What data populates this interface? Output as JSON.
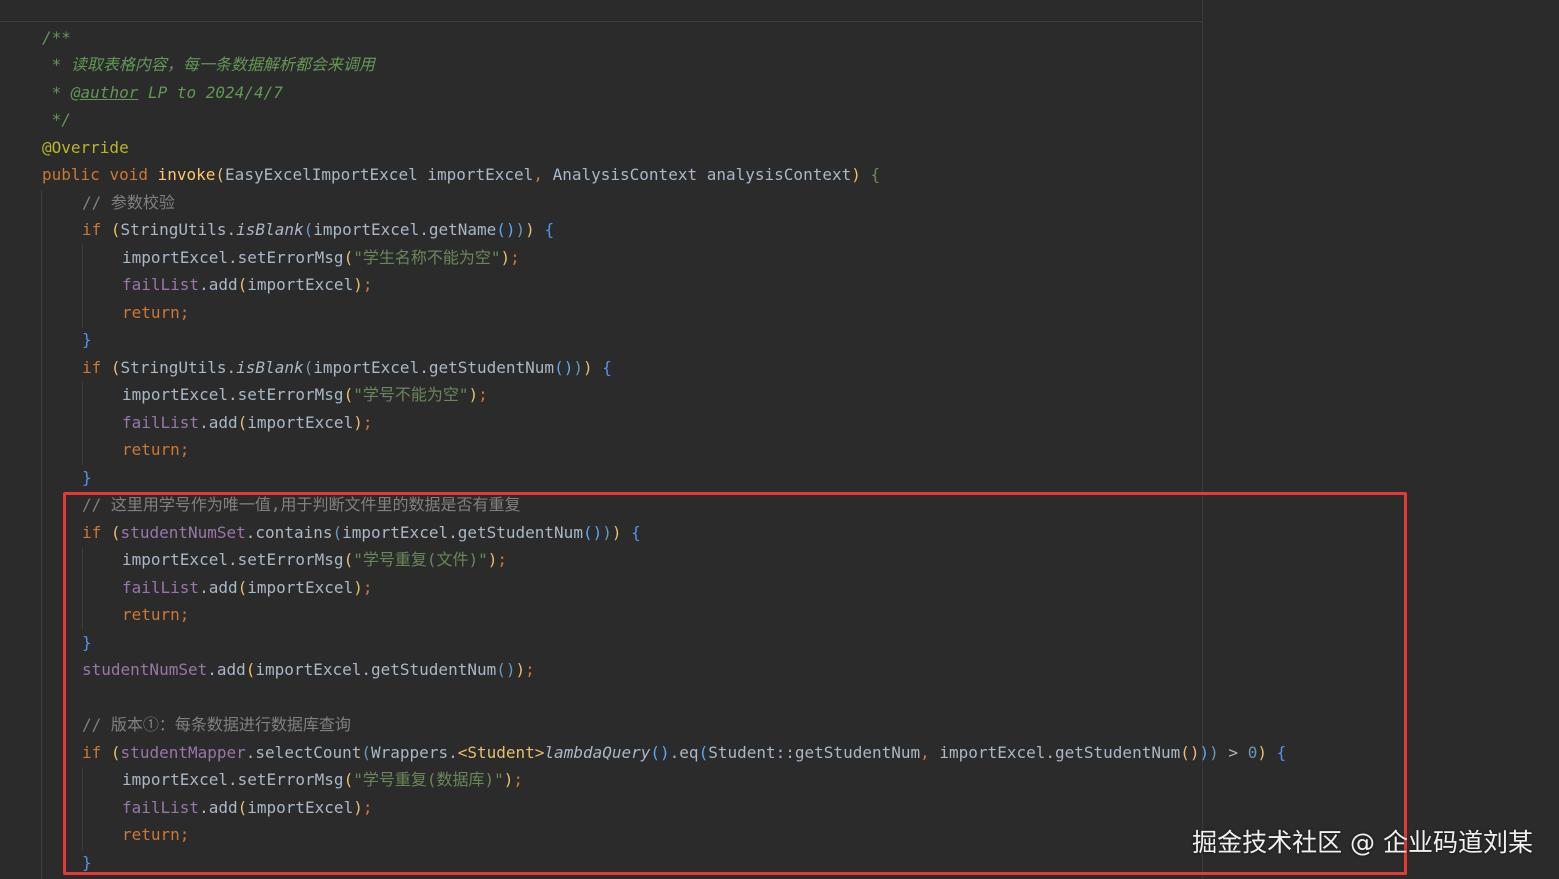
{
  "editor": {
    "javadoc": {
      "open": "/**",
      "desc_prefix": " * ",
      "desc": "读取表格内容，每一条数据解析都会来调用",
      "author_prefix": " * ",
      "author_tag": "@author",
      "author_value": " LP to 2024/4/7",
      "close": " */"
    },
    "annotation": "@Override",
    "signature": {
      "kw_public": "public",
      "kw_void": "void",
      "method": "invoke",
      "paren_open": "(",
      "param1_type": "EasyExcelImportExcel",
      "param1_name": "importExcel",
      "comma": ",",
      "param2_type": "AnalysisContext",
      "param2_name": "analysisContext",
      "paren_close": ")",
      "brace": "{"
    },
    "comment_param_check": "// 参数校验",
    "block_name": {
      "kw_if": "if",
      "util": "StringUtils",
      "check": "isBlank",
      "arg_call": "importExcel.getName",
      "set_msg": "importExcel.setErrorMsg",
      "msg": "\"学生名称不能为空\"",
      "fail_list": "failList",
      "add_call": ".add",
      "add_arg": "importExcel",
      "kw_return": "return",
      "close": "}"
    },
    "block_num": {
      "kw_if": "if",
      "util": "StringUtils",
      "check": "isBlank",
      "arg_call": "importExcel.getStudentNum",
      "set_msg": "importExcel.setErrorMsg",
      "msg": "\"学号不能为空\"",
      "fail_list": "failList",
      "add_call": ".add",
      "add_arg": "importExcel",
      "kw_return": "return",
      "close": "}"
    },
    "comment_unique": "// 这里用学号作为唯一值,用于判断文件里的数据是否有重复",
    "block_dup_file": {
      "kw_if": "if",
      "set_field": "studentNumSet",
      "contains": ".contains",
      "arg_call": "importExcel.getStudentNum",
      "set_msg": "importExcel.setErrorMsg",
      "msg": "\"学号重复(文件)\"",
      "fail_list": "failList",
      "add_call": ".add",
      "add_arg": "importExcel",
      "kw_return": "return",
      "close": "}"
    },
    "add_to_set": {
      "field": "studentNumSet",
      "call": ".add",
      "arg": "importExcel.getStudentNum"
    },
    "comment_version": "// 版本①：每条数据进行数据库查询",
    "block_dup_db": {
      "kw_if": "if",
      "mapper": "studentMapper",
      "select": ".selectCount",
      "wrappers": "Wrappers.",
      "generic": "<Student>",
      "lambda": "lambdaQuery",
      "eq": ".eq",
      "ref": "Student::getStudentNum",
      "arg_call": "importExcel.getStudentNum",
      "gt": " > ",
      "zero": "0",
      "set_msg": "importExcel.setErrorMsg",
      "msg": "\"学号重复(数据库)\"",
      "fail_list": "failList",
      "add_call": ".add",
      "add_arg": "importExcel",
      "kw_return": "return",
      "close": "}"
    }
  },
  "watermark": "掘金技术社区 @ 企业码道刘某",
  "colors": {
    "background": "#2b2b2b",
    "highlight_box": "#e53935",
    "keyword": "#cc7832",
    "comment": "#808080",
    "doc_comment": "#629755",
    "string": "#6a8759",
    "field": "#9876aa",
    "method": "#ffc66d",
    "number": "#6897bb"
  }
}
